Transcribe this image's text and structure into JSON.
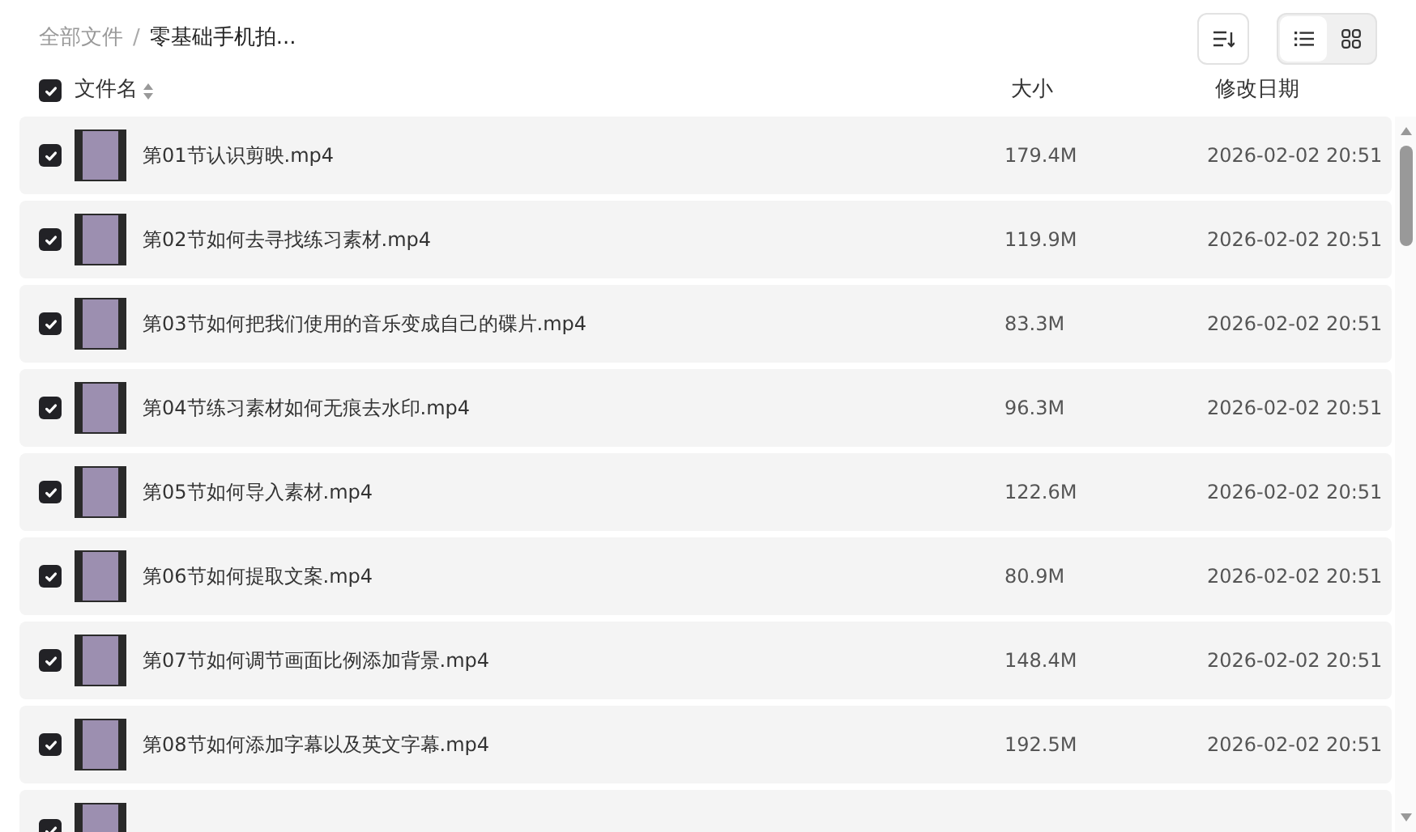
{
  "breadcrumb": [
    {
      "label": "全部文件",
      "current": false
    },
    {
      "label": "零基础手机拍...",
      "current": true
    }
  ],
  "breadcrumb_separator": "/",
  "view_toggle": [
    {
      "kind": "list",
      "selected": true
    },
    {
      "kind": "grid",
      "selected": false
    }
  ],
  "columns": {
    "select_all": {
      "checked": true
    },
    "name": "文件名",
    "size": "大小",
    "date": "修改日期"
  },
  "files": [
    {
      "name": "第01节认识剪映.mp4",
      "size": "179.4M",
      "date": "2026-02-02 20:51",
      "checked": true
    },
    {
      "name": "第02节如何去寻找练习素材.mp4",
      "size": "119.9M",
      "date": "2026-02-02 20:51",
      "checked": true
    },
    {
      "name": "第03节如何把我们使用的音乐变成自己的碟片.mp4",
      "size": "83.3M",
      "date": "2026-02-02 20:51",
      "checked": true
    },
    {
      "name": "第04节练习素材如何无痕去水印.mp4",
      "size": "96.3M",
      "date": "2026-02-02 20:51",
      "checked": true
    },
    {
      "name": "第05节如何导入素材.mp4",
      "size": "122.6M",
      "date": "2026-02-02 20:51",
      "checked": true
    },
    {
      "name": "第06节如何提取文案.mp4",
      "size": "80.9M",
      "date": "2026-02-02 20:51",
      "checked": true
    },
    {
      "name": "第07节如何调节画面比例添加背景.mp4",
      "size": "148.4M",
      "date": "2026-02-02 20:51",
      "checked": true
    },
    {
      "name": "第08节如何添加字幕以及英文字幕.mp4",
      "size": "192.5M",
      "date": "2026-02-02 20:51",
      "checked": true
    }
  ],
  "partial_row": {
    "checked": true
  }
}
